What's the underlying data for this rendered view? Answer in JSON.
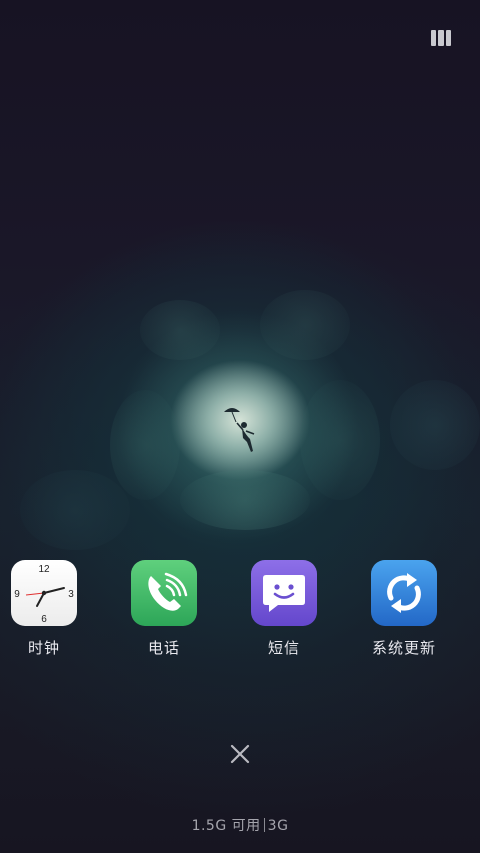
{
  "statusbar": {
    "icons": [
      "recent-grid-icon"
    ]
  },
  "dock": {
    "apps": [
      {
        "label": "时钟",
        "icon": "clock-icon",
        "clock_numerals": [
          "12",
          "3",
          "6",
          "9"
        ],
        "color": "#ffffff"
      },
      {
        "label": "电话",
        "icon": "phone-icon",
        "color": "#3cbb66"
      },
      {
        "label": "短信",
        "icon": "sms-icon",
        "color": "#7657d8"
      },
      {
        "label": "系统更新",
        "icon": "refresh-icon",
        "color": "#3184dc"
      }
    ]
  },
  "footer": {
    "close_icon": "close-icon",
    "memory_available": "1.5G 可用",
    "memory_total": "3G"
  }
}
